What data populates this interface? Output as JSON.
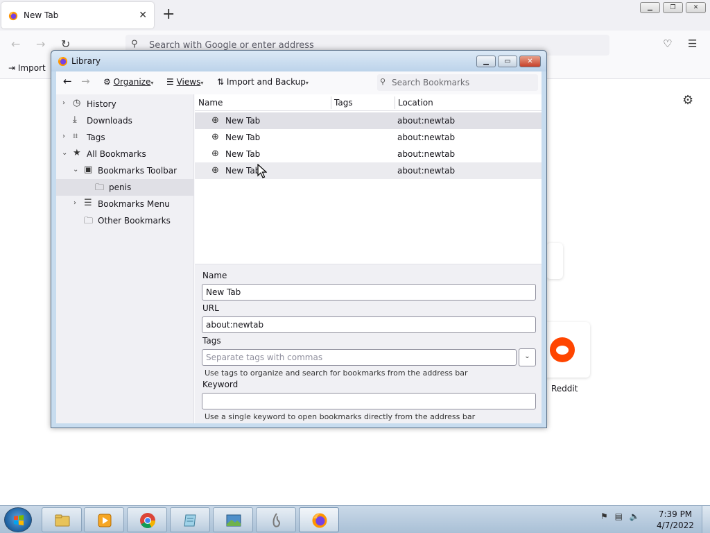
{
  "browser": {
    "tab": {
      "title": "New Tab",
      "close_icon": "close-icon"
    },
    "new_tab_icon": "plus-icon",
    "urlbar": {
      "placeholder": "Search with Google or enter address"
    },
    "bookmarks_toolbar": {
      "import_label": "Import"
    },
    "newtab": {
      "top_site_label": "Reddit"
    }
  },
  "library": {
    "title": "Library",
    "toolbar": {
      "organize_label": "Organize",
      "views_label": "Views",
      "import_backup_label": "Import and Backup",
      "search_placeholder": "Search Bookmarks"
    },
    "tree": [
      {
        "label": "History",
        "icon": "clock-icon"
      },
      {
        "label": "Downloads",
        "icon": "download-icon"
      },
      {
        "label": "Tags",
        "icon": "tag-icon"
      },
      {
        "label": "All Bookmarks",
        "icon": "star-icon"
      },
      {
        "label": "Bookmarks Toolbar",
        "icon": "toolbar-icon"
      },
      {
        "label": "penis",
        "icon": "folder-icon"
      },
      {
        "label": "Bookmarks Menu",
        "icon": "menu-icon"
      },
      {
        "label": "Other Bookmarks",
        "icon": "folder-icon"
      }
    ],
    "columns": {
      "name": "Name",
      "tags": "Tags",
      "location": "Location"
    },
    "rows": [
      {
        "name": "New Tab",
        "tags": "",
        "location": "about:newtab"
      },
      {
        "name": "New Tab",
        "tags": "",
        "location": "about:newtab"
      },
      {
        "name": "New Tab",
        "tags": "",
        "location": "about:newtab"
      },
      {
        "name": "New Tab",
        "tags": "",
        "location": "about:newtab"
      }
    ],
    "details": {
      "name_label": "Name",
      "name_value": "New Tab",
      "url_label": "URL",
      "url_value": "about:newtab",
      "tags_label": "Tags",
      "tags_placeholder": "Separate tags with commas",
      "tags_hint": "Use tags to organize and search for bookmarks from the address bar",
      "keyword_label": "Keyword",
      "keyword_value": "",
      "keyword_hint": "Use a single keyword to open bookmarks directly from the address bar"
    }
  },
  "taskbar": {
    "apps": [
      "file-explorer",
      "media-player",
      "chrome",
      "notepad",
      "photo-viewer",
      "app-6",
      "firefox"
    ],
    "clock_time": "7:39 PM",
    "clock_date": "4/7/2022"
  },
  "colors": {
    "accent": "#0060df",
    "reddit": "#ff4500",
    "selection": "#e0e0e6"
  }
}
